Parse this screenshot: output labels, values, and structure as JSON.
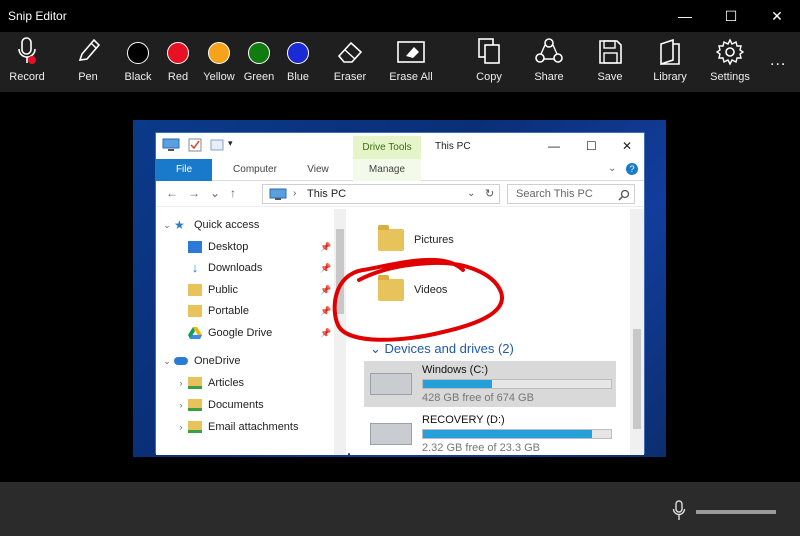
{
  "app": {
    "title": "Snip Editor",
    "window_controls": {
      "minimize": "—",
      "maximize": "☐",
      "close": "✕"
    }
  },
  "toolbar": {
    "tools": [
      {
        "id": "record",
        "label": "Record",
        "icon": "microphone-icon"
      },
      {
        "id": "pen",
        "label": "Pen",
        "icon": "pen-icon"
      },
      {
        "id": "black",
        "label": "Black",
        "color": "#000000"
      },
      {
        "id": "red",
        "label": "Red",
        "color": "#e81123"
      },
      {
        "id": "yellow",
        "label": "Yellow",
        "color": "#f7a21b"
      },
      {
        "id": "green",
        "label": "Green",
        "color": "#107c10"
      },
      {
        "id": "blue",
        "label": "Blue",
        "color": "#1a2bd6"
      },
      {
        "id": "eraser",
        "label": "Eraser",
        "icon": "eraser-icon"
      },
      {
        "id": "erase-all",
        "label": "Erase All",
        "icon": "erase-all-icon"
      },
      {
        "id": "copy",
        "label": "Copy",
        "icon": "copy-icon"
      },
      {
        "id": "share",
        "label": "Share",
        "icon": "share-icon"
      },
      {
        "id": "save",
        "label": "Save",
        "icon": "save-icon"
      },
      {
        "id": "library",
        "label": "Library",
        "icon": "library-icon"
      },
      {
        "id": "settings",
        "label": "Settings",
        "icon": "gear-icon"
      }
    ],
    "more": "..."
  },
  "explorer": {
    "context_tab": "Drive Tools",
    "title": "This PC",
    "tabs": [
      "File",
      "Computer",
      "View",
      "Manage"
    ],
    "address": "This PC",
    "search_placeholder": "Search This PC",
    "nav": [
      {
        "label": "Quick access",
        "chev": "⌄",
        "pinned": false
      },
      {
        "label": "Desktop",
        "chev": "",
        "pinned": true
      },
      {
        "label": "Downloads",
        "chev": "",
        "pinned": true
      },
      {
        "label": "Public",
        "chev": "",
        "pinned": true
      },
      {
        "label": "Portable",
        "chev": "",
        "pinned": true
      },
      {
        "label": "Google Drive",
        "chev": "",
        "pinned": true
      },
      {
        "label": "OneDrive",
        "chev": "⌄",
        "pinned": false
      },
      {
        "label": "Articles",
        "chev": "›",
        "pinned": false
      },
      {
        "label": "Documents",
        "chev": "›",
        "pinned": false
      },
      {
        "label": "Email attachments",
        "chev": "›",
        "pinned": false
      }
    ],
    "folders": [
      {
        "label": "Pictures"
      },
      {
        "label": "Videos"
      }
    ],
    "group_label": "Devices and drives (2)",
    "drives": [
      {
        "name": "Windows (C:)",
        "free": "428 GB free of 674 GB",
        "used_fraction": 0.365,
        "selected": true
      },
      {
        "name": "RECOVERY (D:)",
        "free": "2.32 GB free of 23.3 GB",
        "used_fraction": 0.9,
        "selected": false
      }
    ]
  },
  "colors": {
    "annotation": "#e00000",
    "accent": "#1979ca"
  }
}
